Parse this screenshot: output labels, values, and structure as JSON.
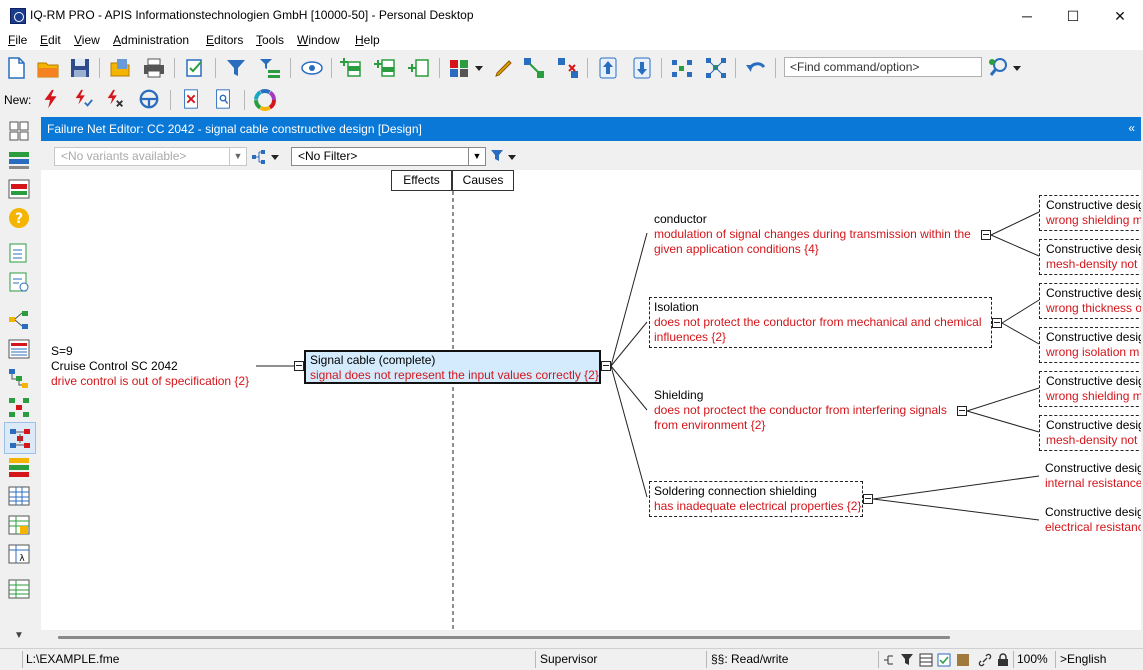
{
  "window": {
    "title": "IQ-RM PRO  - APIS Informationstechnologien GmbH [10000-50] - Personal Desktop",
    "minimize": "─",
    "maximize": "☐",
    "close": "✕"
  },
  "menu": [
    {
      "label": "File",
      "key": "F"
    },
    {
      "label": "Edit",
      "key": "E"
    },
    {
      "label": "View",
      "key": "V"
    },
    {
      "label": "Administration",
      "key": "A"
    },
    {
      "label": "Editors",
      "key": "E"
    },
    {
      "label": "Tools",
      "key": "T"
    },
    {
      "label": "Window",
      "key": "W"
    },
    {
      "label": "Help",
      "key": "H"
    }
  ],
  "toolbar": {
    "find_placeholder": "<Find command/option>",
    "new_label": "New:"
  },
  "editor": {
    "title": "Failure Net Editor: CC 2042 - signal cable constructive design [Design]",
    "collapse": "«",
    "variants_placeholder": "<No variants available>",
    "filter_value": "<No Filter>",
    "tab_effects": "Effects",
    "tab_causes": "Causes"
  },
  "effect_node": {
    "severity": "S=9",
    "name": "Cruise Control SC 2042",
    "failure": "drive control is out of specification {2}"
  },
  "focus_node": {
    "name": "Signal cable (complete)",
    "failure": "signal does not represent the input values correctly {2}"
  },
  "causes": [
    {
      "name": "conductor",
      "failure_line1": "modulation of signal changes during transmission within the",
      "failure_line2": "given application conditions {4}"
    },
    {
      "name": "Isolation",
      "failure_line1": "does not protect the conductor from mechanical and chemical",
      "failure_line2": "influences {2}"
    },
    {
      "name": "Shielding",
      "failure_line1": "does not proctect the conductor from interfering signals",
      "failure_line2": "from environment {2}"
    },
    {
      "name": "Soldering connection shielding",
      "failure_line1": "has inadequate electrical properties {2}",
      "failure_line2": ""
    }
  ],
  "subcauses": [
    {
      "name": "Constructive desig",
      "failure": "wrong shielding m"
    },
    {
      "name": "Constructive desig",
      "failure": "mesh-density not"
    },
    {
      "name": "Constructive desig",
      "failure": "wrong thickness o"
    },
    {
      "name": "Constructive desig",
      "failure": "wrong isolation m"
    },
    {
      "name": "Constructive desig",
      "failure": "wrong shielding m"
    },
    {
      "name": "Constructive desig",
      "failure": "mesh-density not"
    },
    {
      "name": "Constructive desig",
      "failure": "internal resistance"
    },
    {
      "name": "Constructive desig",
      "failure": "electrical resistanc"
    }
  ],
  "status": {
    "file": "L:\\EXAMPLE.fme",
    "user": "Supervisor",
    "access": "§§: Read/write",
    "zoom": "100%",
    "language": ">English"
  },
  "colors": {
    "accent": "#0a78d7",
    "failure_text": "#d4151a",
    "focus_fill": "#d3ebfd"
  }
}
